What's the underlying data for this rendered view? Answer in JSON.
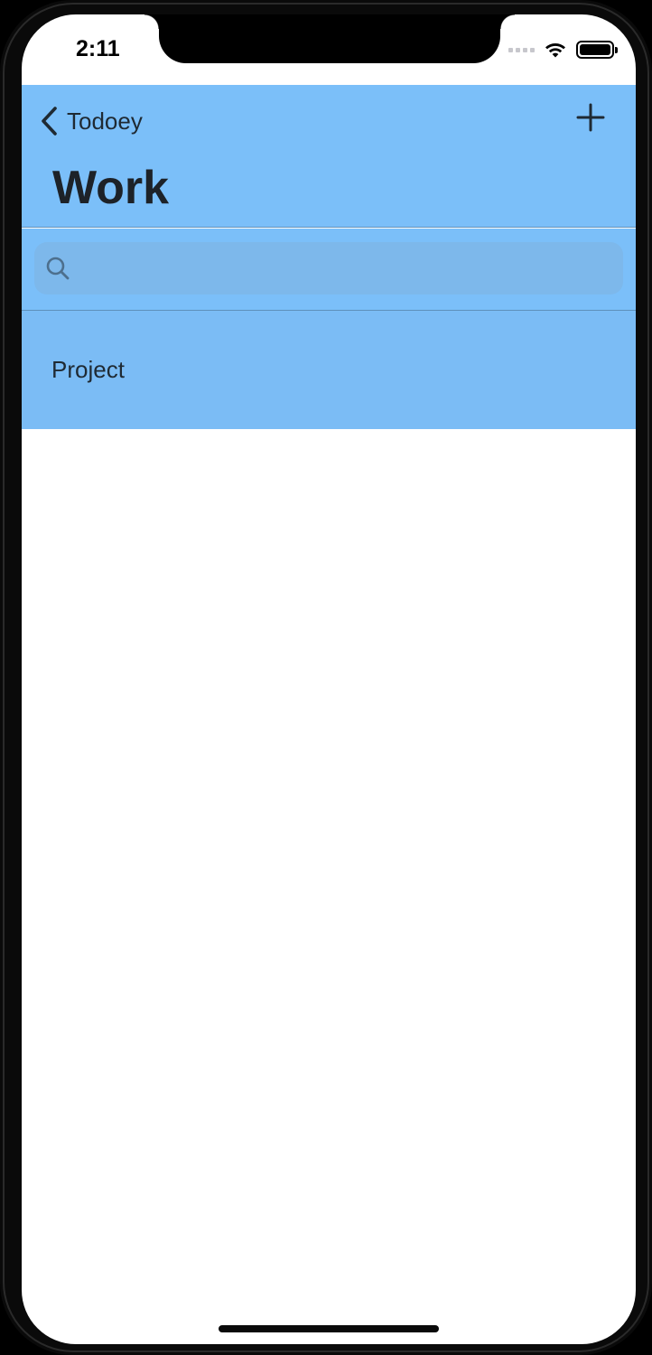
{
  "status_bar": {
    "time": "2:11",
    "icons": [
      "signal-icon",
      "wifi-icon",
      "battery-icon"
    ]
  },
  "navbar": {
    "back_label": "Todoey",
    "title": "Work",
    "back_icon": "chevron-left-icon",
    "add_icon": "plus-icon",
    "background_color": "#7bbff9"
  },
  "search": {
    "placeholder": "",
    "value": "",
    "icon": "search-icon"
  },
  "items": [
    {
      "label": "Project",
      "color": "#7bbcf5"
    }
  ]
}
